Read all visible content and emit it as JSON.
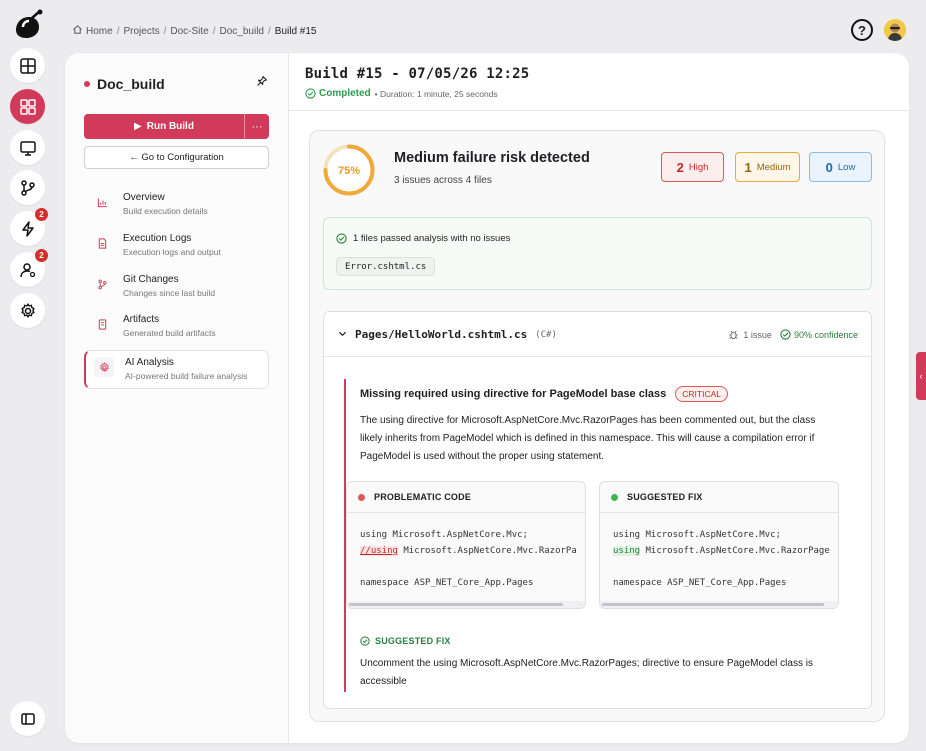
{
  "breadcrumb": {
    "items": [
      "Home",
      "Projects",
      "Doc-Site",
      "Doc_build",
      "Build #15"
    ]
  },
  "rail": {
    "items": [
      {
        "name": "dashboard",
        "icon": "layout-icon"
      },
      {
        "name": "apps",
        "icon": "grid-icon"
      },
      {
        "name": "monitor",
        "icon": "monitor-icon"
      },
      {
        "name": "git",
        "icon": "git-branch-icon"
      },
      {
        "name": "events",
        "icon": "lightning-icon",
        "badge": "2"
      },
      {
        "name": "users",
        "icon": "user-gear-icon",
        "badge": "2"
      },
      {
        "name": "settings",
        "icon": "gear-icon"
      }
    ]
  },
  "sidebar": {
    "title": "Doc_build",
    "run_label": "Run Build",
    "more_label": "···",
    "config_label": "← Go to Configuration",
    "nav": [
      {
        "label": "Overview",
        "sub": "Build execution details",
        "icon": "chart-icon"
      },
      {
        "label": "Execution Logs",
        "sub": "Execution logs and output",
        "icon": "document-icon"
      },
      {
        "label": "Git Changes",
        "sub": "Changes since last build",
        "icon": "git-branch-icon"
      },
      {
        "label": "Artifacts",
        "sub": "Generated build artifacts",
        "icon": "file-icon"
      },
      {
        "label": "AI Analysis",
        "sub": "AI-powered build failure analysis",
        "icon": "gear-icon",
        "active": true
      }
    ]
  },
  "build": {
    "title": "Build #15 - 07/05/26 12:25",
    "status": "Completed",
    "duration": "• Duration: 1 minute, 25 seconds"
  },
  "analysis": {
    "risk_percent": "75%",
    "risk_value": 0.75,
    "title": "Medium failure risk detected",
    "subtitle": "3 issues across 4 files",
    "severity": {
      "high": {
        "count": "2",
        "label": "High"
      },
      "medium": {
        "count": "1",
        "label": "Medium"
      },
      "low": {
        "count": "0",
        "label": "Low"
      }
    },
    "passed": {
      "text": "1 files passed analysis with no issues",
      "files": [
        "Error.cshtml.cs"
      ]
    },
    "file": {
      "name": "Pages/HelloWorld.cshtml.cs",
      "lang": "(C#)",
      "issue_count": "1 issue",
      "confidence": "90% confidence",
      "issue": {
        "title": "Missing required using directive for PageModel base class",
        "severity": "CRITICAL",
        "description": "The using directive for Microsoft.AspNetCore.Mvc.RazorPages has been commented out, but the class likely inherits from PageModel which is defined in this namespace. This will cause a compilation error if PageModel is used without the proper using statement.",
        "problem_label": "PROBLEMATIC CODE",
        "problem_lines": {
          "line1": "using Microsoft.AspNetCore.Mvc;",
          "line2_mark": "//using",
          "line2_rest": " Microsoft.AspNetCore.Mvc.RazorPa",
          "line4": "namespace ASP_NET_Core_App.Pages"
        },
        "fix_label": "SUGGESTED FIX",
        "fix_lines": {
          "line1": "using Microsoft.AspNetCore.Mvc;",
          "line2_mark": "using",
          "line2_rest": " Microsoft.AspNetCore.Mvc.RazorPage",
          "line4": "namespace ASP_NET_Core_App.Pages"
        },
        "suggested_fix_label": "SUGGESTED FIX",
        "suggested_fix_text": "Uncomment the using Microsoft.AspNetCore.Mvc.RazorPages; directive to ensure PageModel class is accessible"
      }
    }
  },
  "colors": {
    "accent": "#d13a5a",
    "success": "#2e9a4e",
    "ring": "#f0a93a"
  }
}
